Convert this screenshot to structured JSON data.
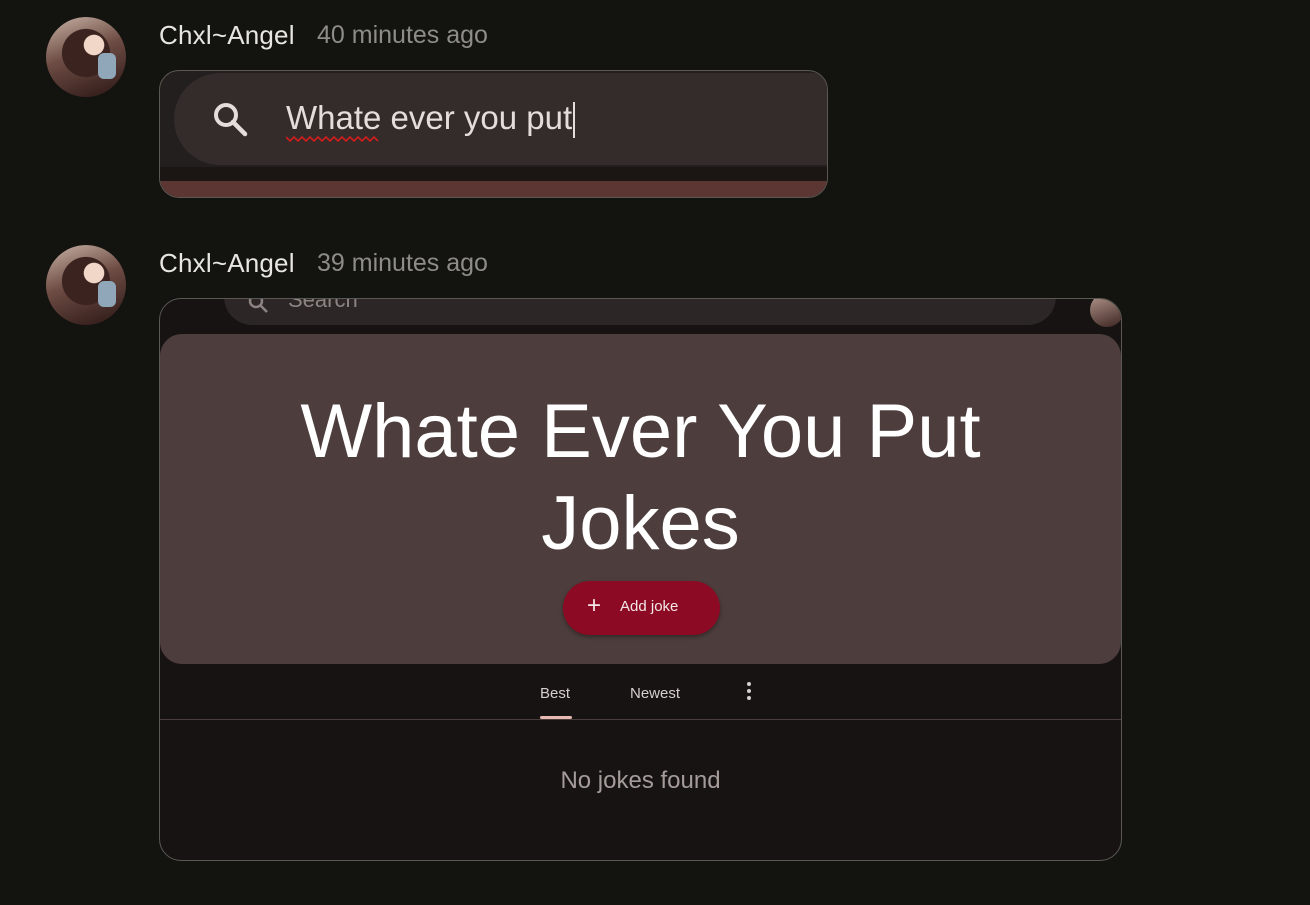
{
  "messages": [
    {
      "author": "Chxl~Angel",
      "timestamp": "40 minutes ago",
      "attachment": {
        "search_text": "Whate ever you put"
      }
    },
    {
      "author": "Chxl~Angel",
      "timestamp": "39 minutes ago",
      "attachment": {
        "search_label": "Search",
        "hero_title_line1": "Whate Ever You Put",
        "hero_title_line2": "Jokes",
        "add_button_label": "Add joke",
        "tabs": [
          "Best",
          "Newest"
        ],
        "empty_state": "No jokes found"
      }
    }
  ],
  "colors": {
    "background": "#13130f",
    "accent_button": "#8c0a24",
    "hero": "#4d3e3d"
  }
}
